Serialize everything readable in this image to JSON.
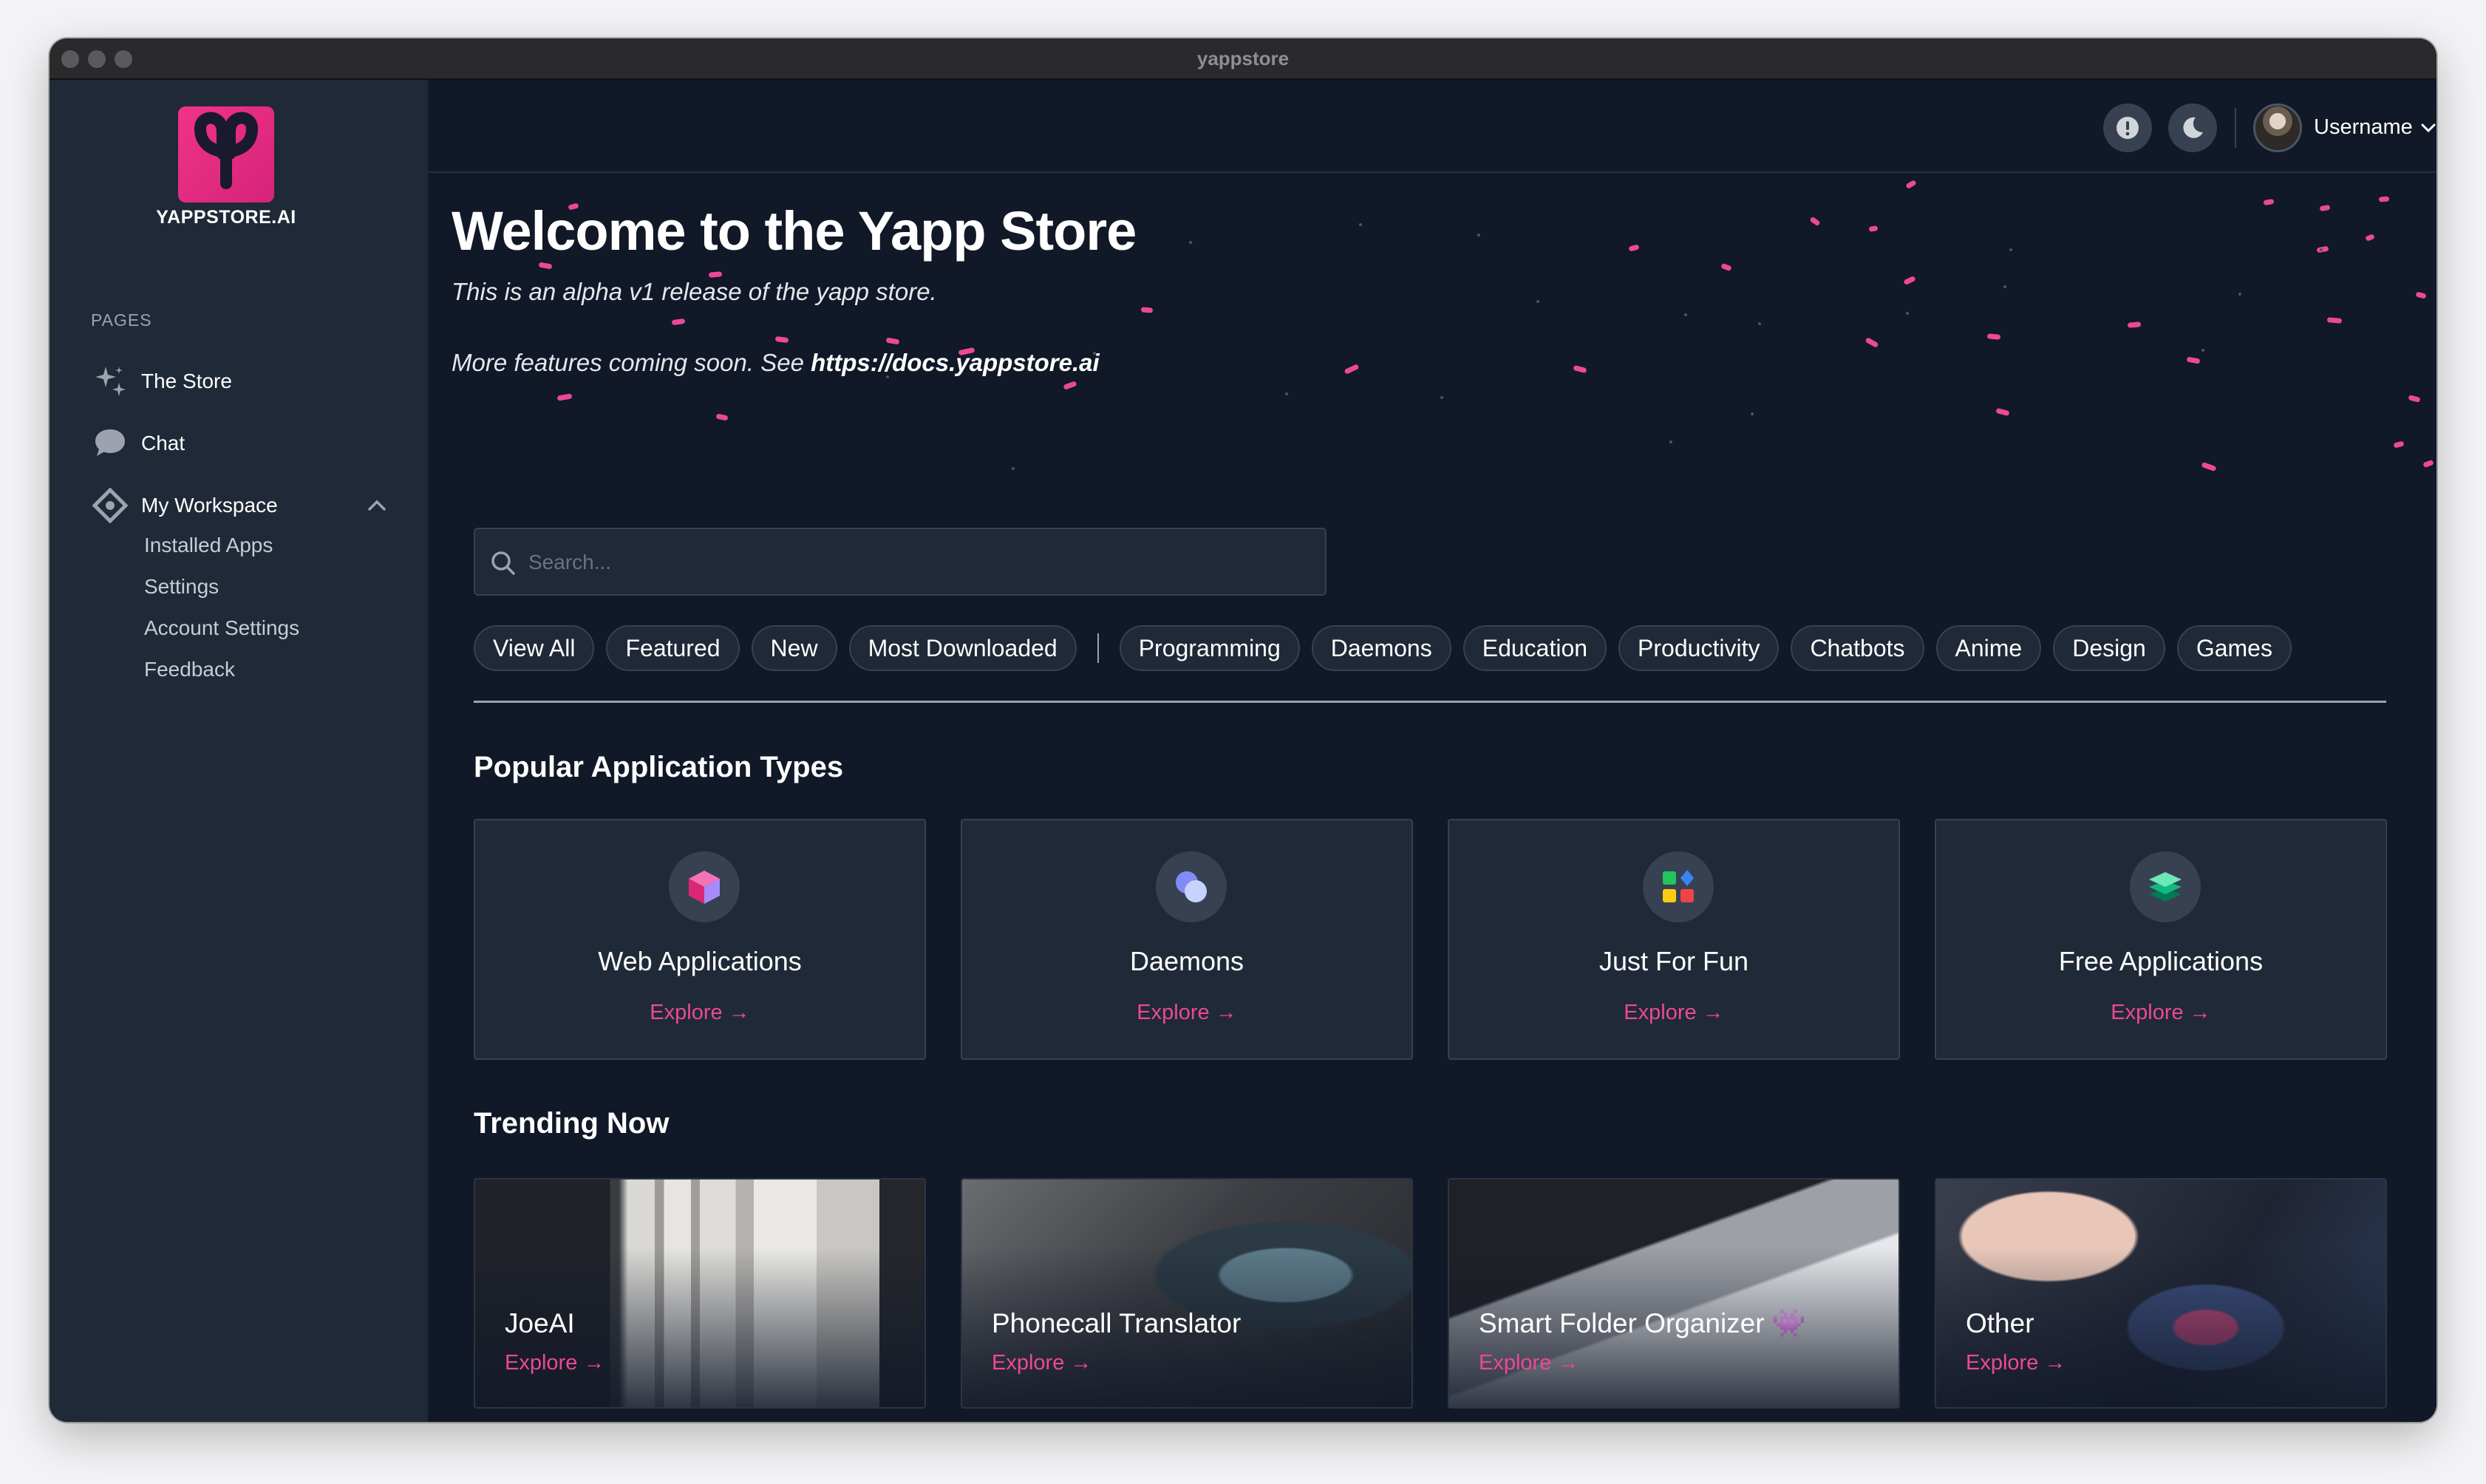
{
  "window": {
    "title": "yappstore"
  },
  "sidebar": {
    "logo_text": "YAPPSTORE.AI",
    "pages_label": "PAGES",
    "items": [
      {
        "label": "The Store",
        "icon": "sparkles-icon"
      },
      {
        "label": "Chat",
        "icon": "chat-bubble-icon"
      },
      {
        "label": "My Workspace",
        "icon": "workspace-icon"
      }
    ],
    "workspace_sub": [
      "Installed Apps",
      "Settings",
      "Account Settings",
      "Feedback"
    ]
  },
  "topbar": {
    "username": "Username"
  },
  "hero": {
    "title": "Welcome to the Yapp Store",
    "line1": "This is an alpha v1 release of the yapp store.",
    "line2_prefix": "More features coming soon. See ",
    "line2_link": "https://docs.yappstore.ai"
  },
  "search": {
    "placeholder": "Search..."
  },
  "filters": {
    "primary": [
      "View All",
      "Featured",
      "New",
      "Most Downloaded"
    ],
    "categories": [
      "Programming",
      "Daemons",
      "Education",
      "Productivity",
      "Chatbots",
      "Anime",
      "Design",
      "Games"
    ]
  },
  "popular": {
    "title": "Popular Application Types",
    "explore_label": "Explore →",
    "cards": [
      {
        "name": "Web Applications",
        "icon": "cube-icon"
      },
      {
        "name": "Daemons",
        "icon": "bubbles-icon"
      },
      {
        "name": "Just For Fun",
        "icon": "shapes-icon"
      },
      {
        "name": "Free Applications",
        "icon": "layers-icon"
      }
    ]
  },
  "trending": {
    "title": "Trending Now",
    "explore_label": "Explore →",
    "cards": [
      {
        "name": "JoeAI",
        "emoji": ""
      },
      {
        "name": "Phonecall Translator",
        "emoji": ""
      },
      {
        "name": "Smart Folder Organizer",
        "emoji": "👾"
      },
      {
        "name": "Other",
        "emoji": ""
      }
    ]
  },
  "colors": {
    "accent": "#ec4899",
    "bg": "#111827",
    "panel": "#1f2937",
    "border": "#374151"
  }
}
